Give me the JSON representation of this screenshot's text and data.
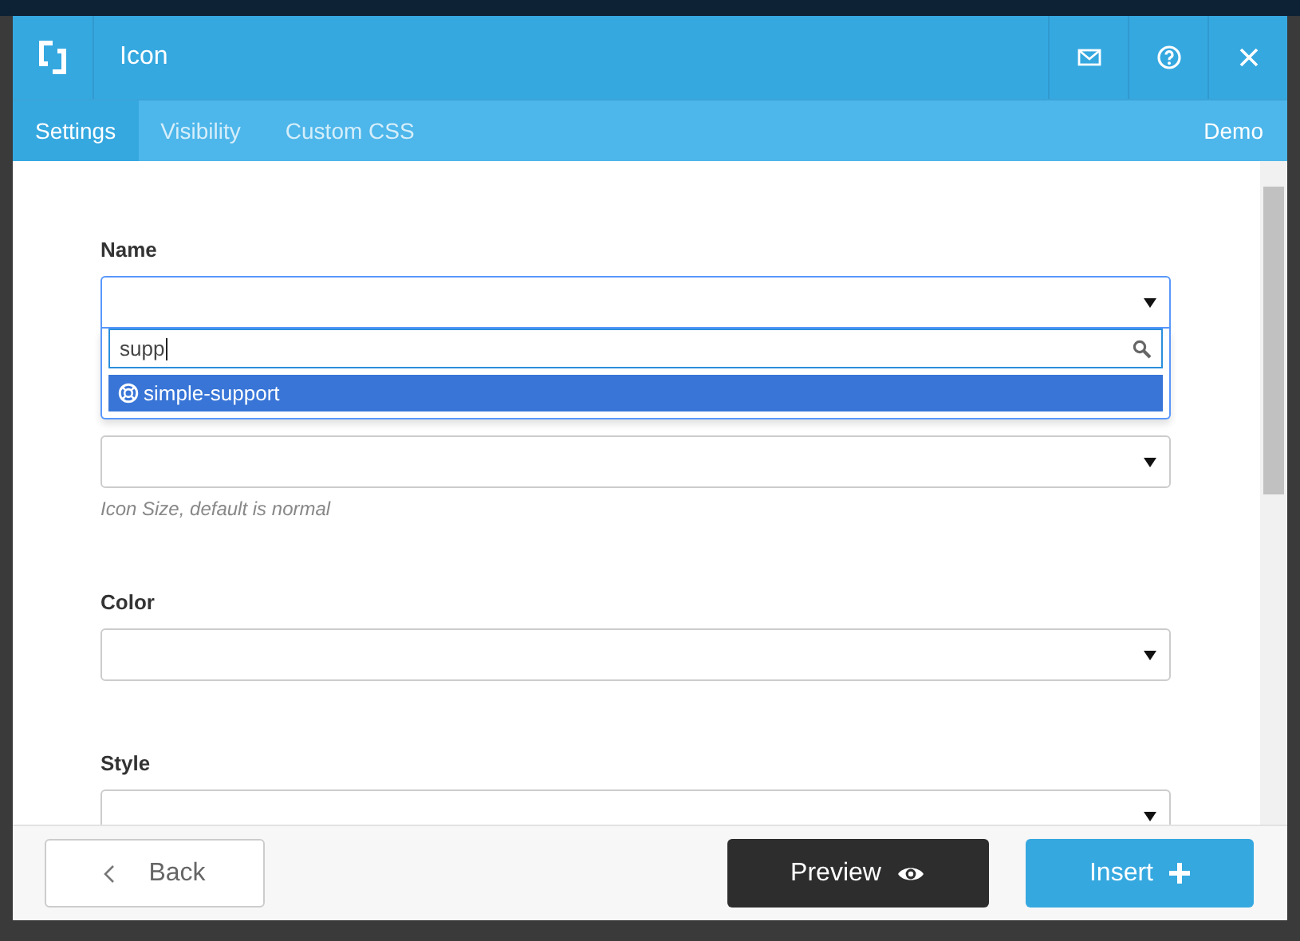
{
  "window": {
    "title": "Icon",
    "header_buttons": [
      {
        "kind": "mail"
      },
      {
        "kind": "help"
      },
      {
        "kind": "close"
      }
    ]
  },
  "tabs": [
    {
      "label": "Settings",
      "selected": true
    },
    {
      "label": "Visibility",
      "selected": false
    },
    {
      "label": "Custom CSS",
      "selected": false
    }
  ],
  "demo_link": "Demo",
  "fields": [
    {
      "label": "Name",
      "open": true,
      "search": {
        "value": "supp"
      },
      "options": [
        {
          "label": "simple-support",
          "selected": true
        }
      ]
    },
    {
      "hint": "Icon Size, default is normal",
      "open": false
    },
    {
      "label": "Color",
      "open": false
    },
    {
      "label": "Style",
      "open": false
    }
  ],
  "footer": {
    "back": "Back",
    "preview": "Preview",
    "insert": "Insert"
  }
}
